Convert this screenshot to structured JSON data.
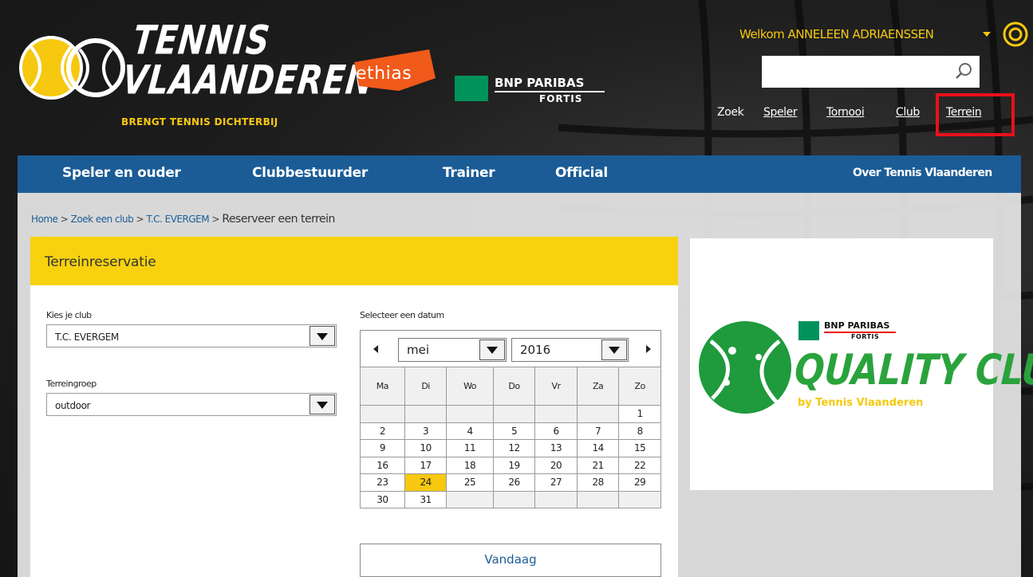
{
  "header": {
    "logo": {
      "line1": "TENNIS",
      "line2": "VLAANDEREN",
      "tagline": "BRENGT TENNIS DICHTERBIJ"
    },
    "sponsors": {
      "ethias": "ethias",
      "bnp_line1": "BNP PARIBAS",
      "bnp_line2": "FORTIS"
    },
    "welcome": "Welkom ANNELEEN ADRIAENSSEN",
    "search": {
      "value": "",
      "placeholder": ""
    },
    "links": {
      "zoek": "Zoek",
      "speler": "Speler",
      "tornooi": "Tornooi",
      "club": "Club",
      "terrein": "Terrein"
    }
  },
  "nav": {
    "items": [
      "Speler en ouder",
      "Clubbestuurder",
      "Trainer",
      "Official"
    ],
    "right": "Over Tennis Vlaanderen",
    "color": "#1b5c96"
  },
  "breadcrumb": {
    "home": "Home",
    "search_club": "Zoek een club",
    "club": "T.C. EVERGEM",
    "current": "Reserveer een terrein",
    "sep": ">"
  },
  "panel": {
    "title": "Terreinreservatie",
    "club_label": "Kies je club",
    "club_value": "T.C. EVERGEM",
    "group_label": "Terreingroep",
    "group_value": "outdoor",
    "date_label": "Selecteer een datum"
  },
  "calendar": {
    "month": "mei",
    "year": "2016",
    "weekdays": [
      "Ma",
      "Di",
      "Wo",
      "Do",
      "Vr",
      "Za",
      "Zo"
    ],
    "weeks": [
      [
        "",
        "",
        "",
        "",
        "",
        "",
        "1"
      ],
      [
        "2",
        "3",
        "4",
        "5",
        "6",
        "7",
        "8"
      ],
      [
        "9",
        "10",
        "11",
        "12",
        "13",
        "14",
        "15"
      ],
      [
        "16",
        "17",
        "18",
        "19",
        "20",
        "21",
        "22"
      ],
      [
        "23",
        "24",
        "25",
        "26",
        "27",
        "28",
        "29"
      ],
      [
        "30",
        "31",
        "",
        "",
        "",
        "",
        ""
      ]
    ],
    "today": "24",
    "today_button": "Vandaag"
  },
  "banner": {
    "bnp_line1": "BNP PARIBAS",
    "bnp_line2": "FORTIS",
    "title": "QUALITY CLUB",
    "subtitle": "by Tennis Vlaanderen"
  },
  "colors": {
    "accent": "#f6c810",
    "nav": "#1b5c96",
    "highlight": "#e8101a",
    "green": "#2aa33c"
  }
}
